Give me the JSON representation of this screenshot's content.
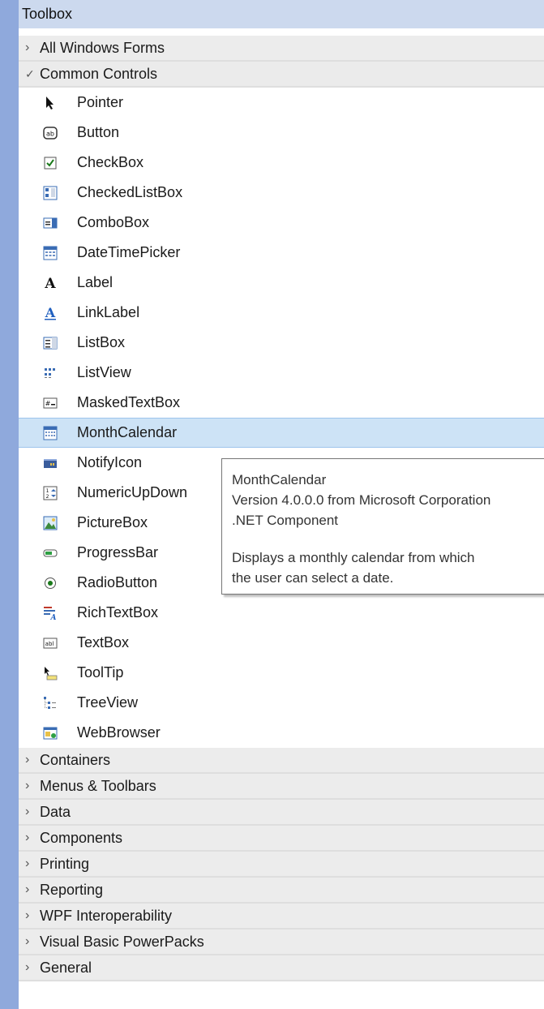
{
  "window": {
    "title": "Toolbox"
  },
  "categories_top": [
    {
      "label": "All Windows Forms"
    }
  ],
  "common_controls": {
    "label": "Common Controls",
    "items": [
      {
        "label": "Pointer",
        "icon": "pointer-icon"
      },
      {
        "label": "Button",
        "icon": "button-icon"
      },
      {
        "label": "CheckBox",
        "icon": "checkbox-icon"
      },
      {
        "label": "CheckedListBox",
        "icon": "checkedlistbox-icon"
      },
      {
        "label": "ComboBox",
        "icon": "combobox-icon"
      },
      {
        "label": "DateTimePicker",
        "icon": "datetimepicker-icon"
      },
      {
        "label": "Label",
        "icon": "label-icon"
      },
      {
        "label": "LinkLabel",
        "icon": "linklabel-icon"
      },
      {
        "label": "ListBox",
        "icon": "listbox-icon"
      },
      {
        "label": "ListView",
        "icon": "listview-icon"
      },
      {
        "label": "MaskedTextBox",
        "icon": "maskedtextbox-icon"
      },
      {
        "label": "MonthCalendar",
        "icon": "monthcalendar-icon"
      },
      {
        "label": "NotifyIcon",
        "icon": "notifyicon-icon"
      },
      {
        "label": "NumericUpDown",
        "icon": "numericupdown-icon"
      },
      {
        "label": "PictureBox",
        "icon": "picturebox-icon"
      },
      {
        "label": "ProgressBar",
        "icon": "progressbar-icon"
      },
      {
        "label": "RadioButton",
        "icon": "radiobutton-icon"
      },
      {
        "label": "RichTextBox",
        "icon": "richtextbox-icon"
      },
      {
        "label": "TextBox",
        "icon": "textbox-icon"
      },
      {
        "label": "ToolTip",
        "icon": "tooltip-icon"
      },
      {
        "label": "TreeView",
        "icon": "treeview-icon"
      },
      {
        "label": "WebBrowser",
        "icon": "webbrowser-icon"
      }
    ],
    "selected": "MonthCalendar"
  },
  "categories_bottom": [
    {
      "label": "Containers"
    },
    {
      "label": "Menus & Toolbars"
    },
    {
      "label": "Data"
    },
    {
      "label": "Components"
    },
    {
      "label": "Printing"
    },
    {
      "label": "Reporting"
    },
    {
      "label": "WPF Interoperability"
    },
    {
      "label": "Visual Basic PowerPacks"
    },
    {
      "label": "General"
    }
  ],
  "tooltip": {
    "title": "MonthCalendar",
    "version": "Version 4.0.0.0 from Microsoft Corporation",
    "component": ".NET Component",
    "description_line1": "Displays a monthly calendar from which",
    "description_line2": "the user can select a date."
  },
  "colors": {
    "background": "#8fa9dc",
    "titlebar": "#ccd9ee",
    "selection": "#cde3f6"
  }
}
